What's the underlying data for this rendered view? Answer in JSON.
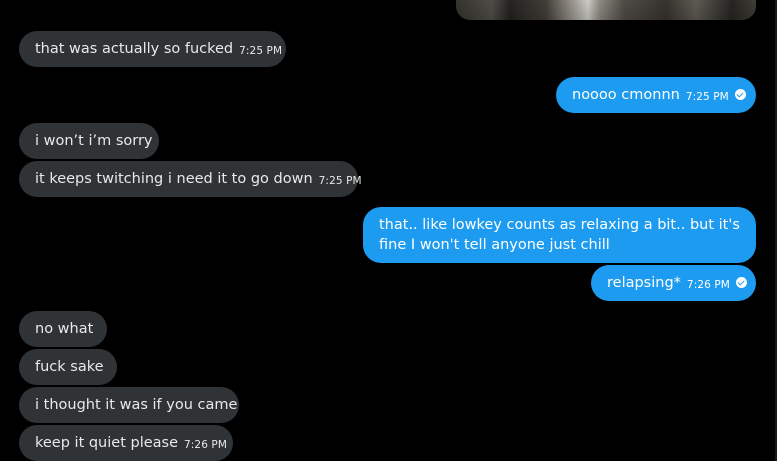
{
  "conversation": {
    "image_message": {
      "alt": "",
      "icon": "photo"
    },
    "messages": [
      {
        "direction": "in",
        "text": "that was actually so fucked",
        "time": "7:25 PM"
      },
      {
        "direction": "out",
        "text": "noooo cmonnn",
        "time": "7:25 PM",
        "status": "seen-check-icon"
      },
      {
        "direction": "in",
        "text": "i won’t i’m sorry",
        "time": ""
      },
      {
        "direction": "in",
        "text": "it keeps twitching i need it to go down",
        "time": "7:25 PM"
      },
      {
        "direction": "out",
        "text": "that..  like lowkey counts as relaxing a bit.. but it's fine I won't tell anyone just chill",
        "time": ""
      },
      {
        "direction": "out",
        "text": "relapsing*",
        "time": "7:26 PM",
        "status": "seen-check-icon"
      },
      {
        "direction": "in",
        "text": "no what",
        "time": ""
      },
      {
        "direction": "in",
        "text": "fuck sake",
        "time": ""
      },
      {
        "direction": "in",
        "text": "i thought it was if you came",
        "time": ""
      },
      {
        "direction": "in",
        "text": "keep it quiet please",
        "time": "7:26 PM"
      }
    ]
  },
  "colors": {
    "background": "#000000",
    "incoming_bubble": "#2f3336",
    "outgoing_bubble": "#1d9bf0",
    "text_primary": "#e7e9ea",
    "text_on_blue": "#ffffff"
  }
}
